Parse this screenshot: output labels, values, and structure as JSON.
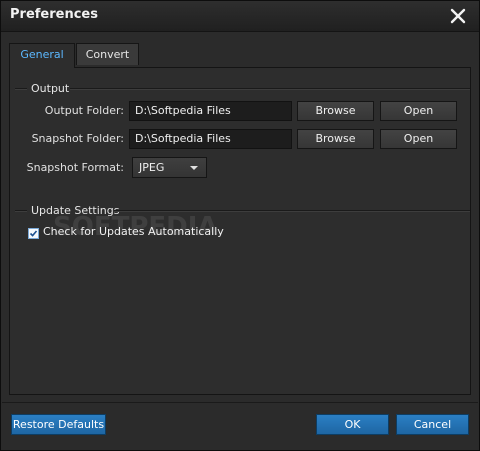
{
  "window": {
    "title": "Preferences"
  },
  "tabs": [
    {
      "label": "General",
      "active": true
    },
    {
      "label": "Convert",
      "active": false
    }
  ],
  "output": {
    "group_label": "Output",
    "output_folder": {
      "label": "Output Folder:",
      "value": "D:\\Softpedia Files",
      "browse_label": "Browse",
      "open_label": "Open"
    },
    "snapshot_folder": {
      "label": "Snapshot Folder:",
      "value": "D:\\Softpedia Files",
      "browse_label": "Browse",
      "open_label": "Open"
    },
    "snapshot_format": {
      "label": "Snapshot Format:",
      "selected": "JPEG"
    }
  },
  "update": {
    "group_label": "Update Settings",
    "auto_check": {
      "label": "Check for Updates Automatically",
      "checked": true
    }
  },
  "watermark": "SOFTPEDIA",
  "footer": {
    "restore_label": "Restore Defaults",
    "ok_label": "OK",
    "cancel_label": "Cancel"
  },
  "colors": {
    "accent_blue": "#1e66a3",
    "active_tab_text": "#5cb8ff",
    "background": "#2d2d2d"
  },
  "icons": {
    "close": "close-icon",
    "dropdown": "chevron-down-icon",
    "check": "check-icon"
  }
}
